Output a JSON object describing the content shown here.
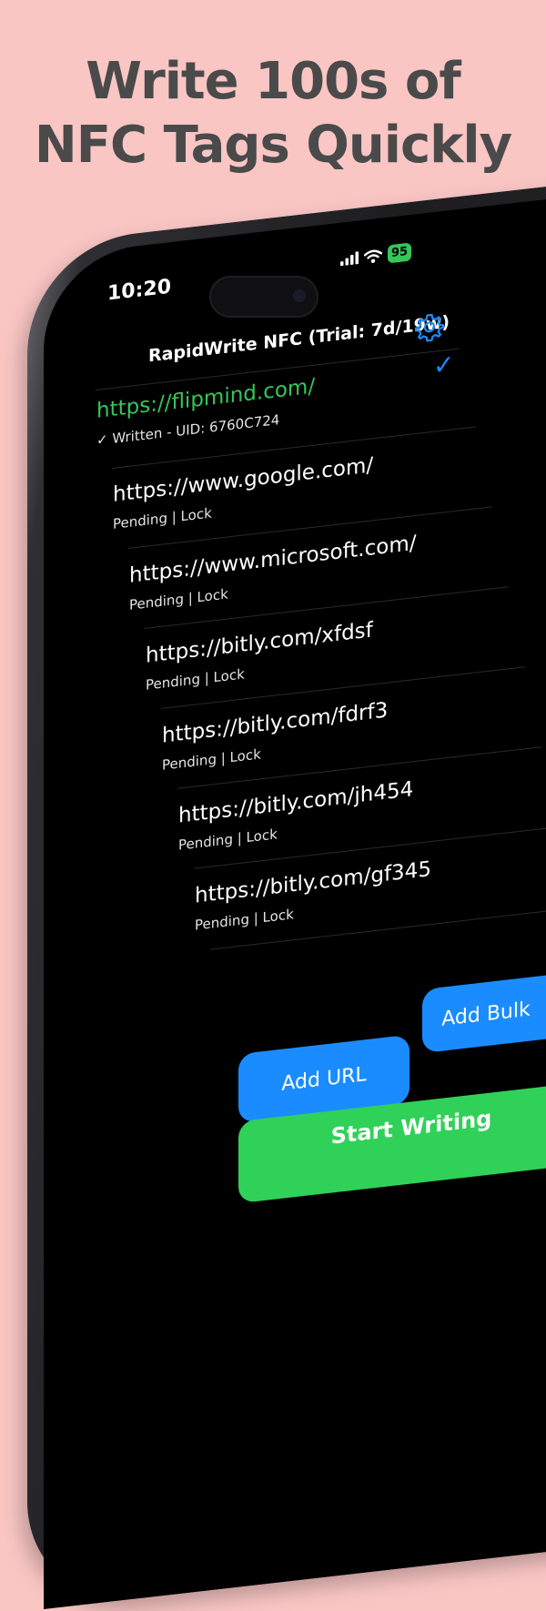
{
  "headline": {
    "line1": "Write 100s of",
    "line2": "NFC Tags Quickly"
  },
  "status_bar": {
    "time": "10:20",
    "battery": "95"
  },
  "header": {
    "title": "RapidWrite NFC (Trial: 7d/19w)",
    "settings_icon": "gear-icon"
  },
  "tags": [
    {
      "url": "https://flipmind.com/",
      "status": "✓ Written - UID: 6760C724",
      "written": true
    },
    {
      "url": "https://www.google.com/",
      "status": "Pending | Lock",
      "written": false
    },
    {
      "url": "https://www.microsoft.com/",
      "status": "Pending | Lock",
      "written": false
    },
    {
      "url": "https://bitly.com/xfdsf",
      "status": "Pending | Lock",
      "written": false
    },
    {
      "url": "https://bitly.com/fdrf3",
      "status": "Pending | Lock",
      "written": false
    },
    {
      "url": "https://bitly.com/jh454",
      "status": "Pending | Lock",
      "written": false
    },
    {
      "url": "https://bitly.com/gf345",
      "status": "Pending | Lock",
      "written": false
    }
  ],
  "buttons": {
    "add_url": "Add URL",
    "add_bulk": "Add Bulk",
    "start_writing": "Start Writing"
  },
  "colors": {
    "background": "#f9c6c4",
    "accent_blue": "#1a8cff",
    "accent_green": "#34c759",
    "headline": "#4a4a4a"
  }
}
